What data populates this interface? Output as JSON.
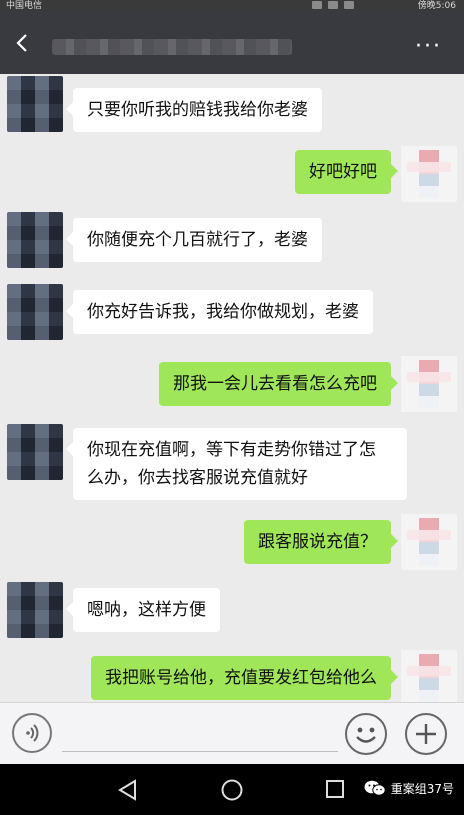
{
  "status_bar": {
    "carrier": "中国电信",
    "time": "傍晚5:06"
  },
  "nav": {
    "more": "···"
  },
  "messages": [
    {
      "side": "left",
      "text": "只要你听我的赔钱我给你老婆"
    },
    {
      "side": "right",
      "text": "好吧好吧"
    },
    {
      "side": "left",
      "text": "你随便充个几百就行了，老婆"
    },
    {
      "side": "left",
      "text": "你充好告诉我，我给你做规划，老婆"
    },
    {
      "side": "right",
      "text": "那我一会儿去看看怎么充吧"
    },
    {
      "side": "left",
      "text_line1": "你现在充值啊，等下有走势你错过了怎",
      "text_line2": "么办，你去找客服说充值就好"
    },
    {
      "side": "right",
      "text": "跟客服说充值？"
    },
    {
      "side": "left",
      "text": "嗯呐，这样方便"
    },
    {
      "side": "right",
      "text": "我把账号给他，充值要发红包给他么"
    }
  ],
  "watermark": {
    "text": "重案组37号"
  },
  "colors": {
    "nav_bg": "#393a3f",
    "chat_bg": "#ebebeb",
    "bubble_right": "#9fe658",
    "bubble_left": "#ffffff"
  },
  "icons": [
    "back-arrow-icon",
    "more-icon",
    "voice-icon",
    "emoji-icon",
    "plus-icon",
    "back-triangle-icon",
    "home-circle-icon",
    "recents-square-icon",
    "wechat-icon"
  ]
}
